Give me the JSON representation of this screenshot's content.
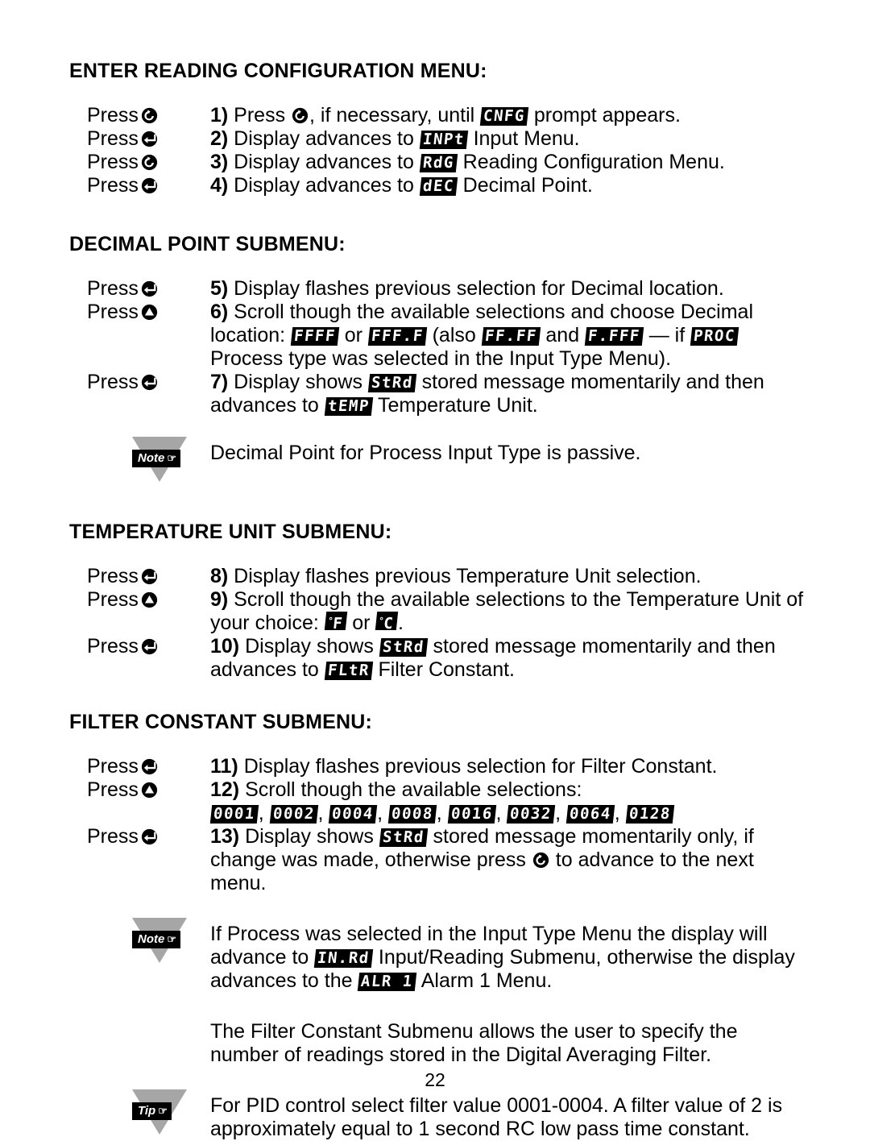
{
  "page": {
    "number": "22"
  },
  "icons": {
    "menu_button": "menu-circular-arrow-icon",
    "enter_button": "enter-return-arrow-icon",
    "up_button": "up-arrow-circle-icon",
    "hand_pointer": "pointing-hand-icon"
  },
  "sections": [
    {
      "id": "enter-reading-configuration-menu",
      "heading": "ENTER READING CONFIGURATION MENU:",
      "rows": [
        {
          "press_label": "Press",
          "press_icon": "menu",
          "step": "1)",
          "parts": [
            {
              "t": "text",
              "v": " Press "
            },
            {
              "t": "icon",
              "v": "menu"
            },
            {
              "t": "text",
              "v": ", if necessary, until "
            },
            {
              "t": "lcd",
              "v": "CNFG"
            },
            {
              "t": "text",
              "v": " prompt appears."
            }
          ]
        },
        {
          "press_label": "Press",
          "press_icon": "enter",
          "step": "2)",
          "parts": [
            {
              "t": "text",
              "v": " Display advances to "
            },
            {
              "t": "lcd",
              "v": "INPt"
            },
            {
              "t": "text",
              "v": " Input Menu."
            }
          ]
        },
        {
          "press_label": "Press",
          "press_icon": "menu",
          "step": "3)",
          "parts": [
            {
              "t": "text",
              "v": " Display advances to "
            },
            {
              "t": "lcd",
              "v": "RdG"
            },
            {
              "t": "text",
              "v": " Reading Configuration Menu."
            }
          ]
        },
        {
          "press_label": "Press",
          "press_icon": "enter",
          "step": "4)",
          "parts": [
            {
              "t": "text",
              "v": " Display advances to "
            },
            {
              "t": "lcd",
              "v": "dEC"
            },
            {
              "t": "text",
              "v": " Decimal Point."
            }
          ]
        }
      ]
    },
    {
      "id": "decimal-point-submenu",
      "heading": "DECIMAL POINT SUBMENU:",
      "rows": [
        {
          "press_label": "Press",
          "press_icon": "enter",
          "step": "5)",
          "parts": [
            {
              "t": "text",
              "v": " Display flashes previous selection for Decimal location."
            }
          ]
        },
        {
          "press_label": "Press",
          "press_icon": "up",
          "step": "6)",
          "parts": [
            {
              "t": "text",
              "v": " Scroll though the available selections and choose Decimal location: "
            },
            {
              "t": "lcd",
              "v": "FFFF"
            },
            {
              "t": "text",
              "v": " or "
            },
            {
              "t": "lcd",
              "v": "FFF.F"
            },
            {
              "t": "text",
              "v": " (also "
            },
            {
              "t": "lcd",
              "v": "FF.FF"
            },
            {
              "t": "text",
              "v": " and "
            },
            {
              "t": "lcd",
              "v": "F.FFF"
            },
            {
              "t": "text",
              "v": " — if "
            },
            {
              "t": "lcd",
              "v": "PROC"
            },
            {
              "t": "text",
              "v": " Process type was selected in the Input Type Menu)."
            }
          ]
        },
        {
          "press_label": "Press",
          "press_icon": "enter",
          "step": "7)",
          "parts": [
            {
              "t": "text",
              "v": " Display shows "
            },
            {
              "t": "lcd",
              "v": "StRd"
            },
            {
              "t": "text",
              "v": " stored message momentarily and then advances to "
            },
            {
              "t": "lcd",
              "v": "tEMP"
            },
            {
              "t": "text",
              "v": " Temperature Unit."
            }
          ]
        }
      ],
      "callout": {
        "type": "Note",
        "label": "Note",
        "parts": [
          {
            "t": "text",
            "v": "Decimal Point for Process Input Type is passive."
          }
        ]
      }
    },
    {
      "id": "temperature-unit-submenu",
      "heading": "TEMPERATURE UNIT SUBMENU:",
      "rows": [
        {
          "press_label": "Press",
          "press_icon": "enter",
          "step": "8)",
          "parts": [
            {
              "t": "text",
              "v": " Display flashes previous Temperature Unit selection."
            }
          ]
        },
        {
          "press_label": "Press",
          "press_icon": "up",
          "step": "9)",
          "parts": [
            {
              "t": "text",
              "v": " Scroll though the available selections to the Temperature Unit of your choice: "
            },
            {
              "t": "lcd_deg",
              "v": "F"
            },
            {
              "t": "text",
              "v": " or "
            },
            {
              "t": "lcd_deg",
              "v": "C"
            },
            {
              "t": "text",
              "v": "."
            }
          ]
        },
        {
          "press_label": "Press",
          "press_icon": "enter",
          "step": "10)",
          "parts": [
            {
              "t": "text",
              "v": " Display shows "
            },
            {
              "t": "lcd",
              "v": "StRd"
            },
            {
              "t": "text",
              "v": " stored message momentarily and then advances to "
            },
            {
              "t": "lcd",
              "v": "FLtR"
            },
            {
              "t": "text",
              "v": " Filter Constant."
            }
          ]
        }
      ]
    },
    {
      "id": "filter-constant-submenu",
      "heading": "FILTER CONSTANT SUBMENU:",
      "rows": [
        {
          "press_label": "Press",
          "press_icon": "enter",
          "step": "11)",
          "parts": [
            {
              "t": "text",
              "v": " Display flashes previous selection for Filter Constant."
            }
          ]
        },
        {
          "press_label": "Press",
          "press_icon": "up",
          "step": "12)",
          "parts": [
            {
              "t": "text",
              "v": " Scroll though the available selections: "
            },
            {
              "t": "br",
              "v": ""
            },
            {
              "t": "lcd",
              "v": "0001"
            },
            {
              "t": "text",
              "v": ", "
            },
            {
              "t": "lcd",
              "v": "0002"
            },
            {
              "t": "text",
              "v": ", "
            },
            {
              "t": "lcd",
              "v": "0004"
            },
            {
              "t": "text",
              "v": ", "
            },
            {
              "t": "lcd",
              "v": "0008"
            },
            {
              "t": "text",
              "v": ", "
            },
            {
              "t": "lcd",
              "v": "0016"
            },
            {
              "t": "text",
              "v": ", "
            },
            {
              "t": "lcd",
              "v": "0032"
            },
            {
              "t": "text",
              "v": ", "
            },
            {
              "t": "lcd",
              "v": "0064"
            },
            {
              "t": "text",
              "v": ", "
            },
            {
              "t": "lcd",
              "v": "0128"
            }
          ]
        },
        {
          "press_label": "Press",
          "press_icon": "enter",
          "step": "13)",
          "parts": [
            {
              "t": "text",
              "v": " Display shows "
            },
            {
              "t": "lcd",
              "v": "StRd"
            },
            {
              "t": "text",
              "v": " stored message momentarily only, if change was made, otherwise press "
            },
            {
              "t": "icon",
              "v": "menu"
            },
            {
              "t": "text",
              "v": " to advance to the next menu."
            }
          ]
        }
      ],
      "callouts": [
        {
          "type": "Note",
          "label": "Note",
          "parts": [
            {
              "t": "text",
              "v": "If Process was selected in the Input Type Menu the display will advance to "
            },
            {
              "t": "lcd",
              "v": "IN.Rd"
            },
            {
              "t": "text",
              "v": " Input/Reading Submenu, otherwise the display advances to the "
            },
            {
              "t": "lcd",
              "v": "ALR 1"
            },
            {
              "t": "text",
              "v": " Alarm 1 Menu."
            }
          ]
        },
        {
          "type": "plain",
          "label": "",
          "parts": [
            {
              "t": "text",
              "v": "The Filter Constant Submenu allows the user to specify the number of readings stored in the Digital Averaging Filter."
            }
          ]
        },
        {
          "type": "Tip",
          "label": "Tip",
          "parts": [
            {
              "t": "text",
              "v": "For PID control select filter value 0001-0004. A filter value of 2 is approximately equal to 1 second RC low pass time constant."
            }
          ]
        }
      ]
    }
  ]
}
